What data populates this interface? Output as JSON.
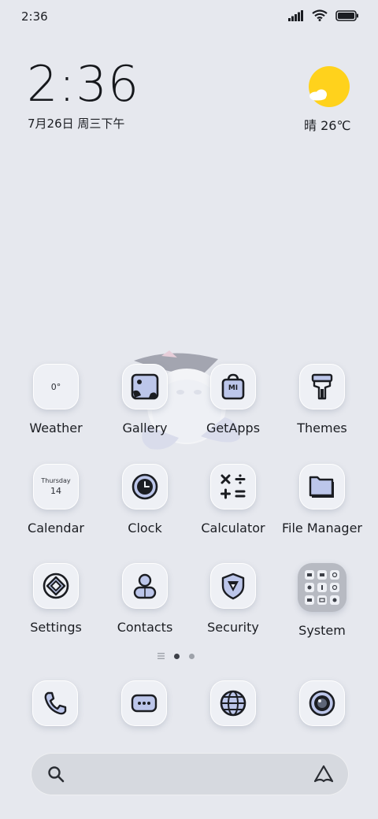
{
  "status_bar": {
    "time": "2:36"
  },
  "clock_widget": {
    "time": "2:36",
    "date": "7月26日 周三下午"
  },
  "weather_widget": {
    "text": "晴 26℃"
  },
  "apps": [
    {
      "id": "weather",
      "label": "Weather",
      "tile_text": "0°"
    },
    {
      "id": "gallery",
      "label": "Gallery"
    },
    {
      "id": "getapps",
      "label": "GetApps",
      "tile_text": "MI"
    },
    {
      "id": "themes",
      "label": "Themes"
    },
    {
      "id": "calendar",
      "label": "Calendar",
      "tile_day": "Thursday",
      "tile_date": "14"
    },
    {
      "id": "clock",
      "label": "Clock"
    },
    {
      "id": "calculator",
      "label": "Calculator"
    },
    {
      "id": "file-manager",
      "label": "File Manager"
    },
    {
      "id": "settings",
      "label": "Settings"
    },
    {
      "id": "contacts",
      "label": "Contacts"
    },
    {
      "id": "security",
      "label": "Security"
    },
    {
      "id": "system",
      "label": "System"
    }
  ],
  "pager": {
    "pages": 2,
    "current": 1
  },
  "dock": [
    "phone",
    "messages",
    "browser",
    "camera"
  ]
}
